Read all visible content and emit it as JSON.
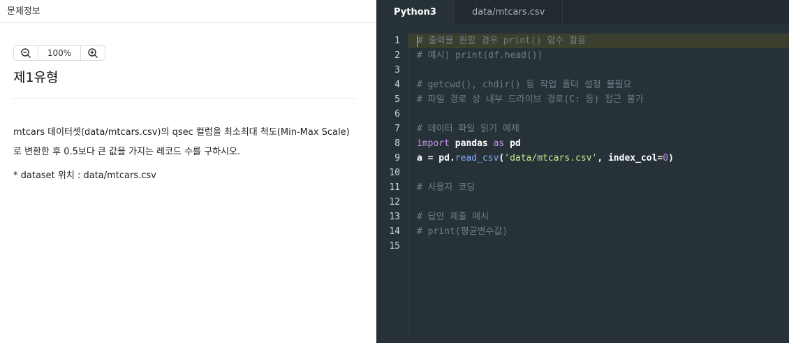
{
  "left": {
    "header_title": "문제정보",
    "zoom_value": "100%",
    "problem_title": "제1유형",
    "description": "mtcars 데이터셋(data/mtcars.csv)의 qsec 컬럼을 최소최대 척도(Min-Max Scale)로 변환한 후 0.5보다 큰 값을 가지는 레코드 수를 구하시오.",
    "dataset_note": "* dataset 위치 : data/mtcars.csv"
  },
  "editor": {
    "tabs": [
      {
        "label": "Python3",
        "active": true
      },
      {
        "label": "data/mtcars.csv",
        "active": false
      }
    ],
    "line_numbers": [
      "1",
      "2",
      "3",
      "4",
      "5",
      "6",
      "7",
      "8",
      "9",
      "10",
      "11",
      "12",
      "13",
      "14",
      "15"
    ],
    "code": {
      "l1": "# 출력을 원할 경우 print() 함수 활용",
      "l2": "# 예시) print(df.head())",
      "l4": "# getcwd(), chdir() 등 작업 폴더 설정 불필요",
      "l5": "# 파일 경로 상 내부 드라이브 경로(C: 등) 접근 불가",
      "l7": "# 데이터 파일 읽기 예제",
      "l8_kw1": "import",
      "l8_mod": " pandas ",
      "l8_kw2": "as",
      "l8_alias": " pd",
      "l9_a": "a = pd.",
      "l9_fn": "read_csv",
      "l9_open": "(",
      "l9_str": "'data/mtcars.csv'",
      "l9_mid": ", index_col=",
      "l9_num": "0",
      "l9_close": ")",
      "l11": "# 사용자 코딩",
      "l13": "# 답안 제출 예시",
      "l14": "# print(평균변수값)"
    }
  },
  "colors": {
    "editor_bg": "#263238",
    "comment": "#6f7e87",
    "keyword": "#c792ea",
    "function": "#82aaff",
    "string": "#c3e88d"
  }
}
